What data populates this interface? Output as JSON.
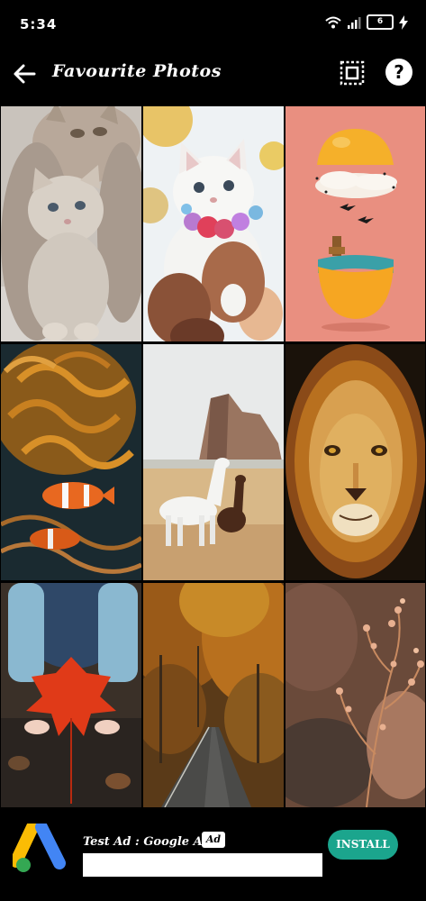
{
  "status_bar": {
    "time": "5:34",
    "battery": "6"
  },
  "app_bar": {
    "title": "Favourite Photos",
    "help_label": "?"
  },
  "photos": [
    {
      "name": "kittens"
    },
    {
      "name": "white-kitten"
    },
    {
      "name": "egg-surreal"
    },
    {
      "name": "clownfish"
    },
    {
      "name": "horses"
    },
    {
      "name": "lion"
    },
    {
      "name": "maple-leaf"
    },
    {
      "name": "autumn-road"
    },
    {
      "name": "dry-flowers"
    }
  ],
  "ad": {
    "title": "Test Ad : Google Ads",
    "badge": "Ad",
    "install_label": "INSTALL"
  }
}
